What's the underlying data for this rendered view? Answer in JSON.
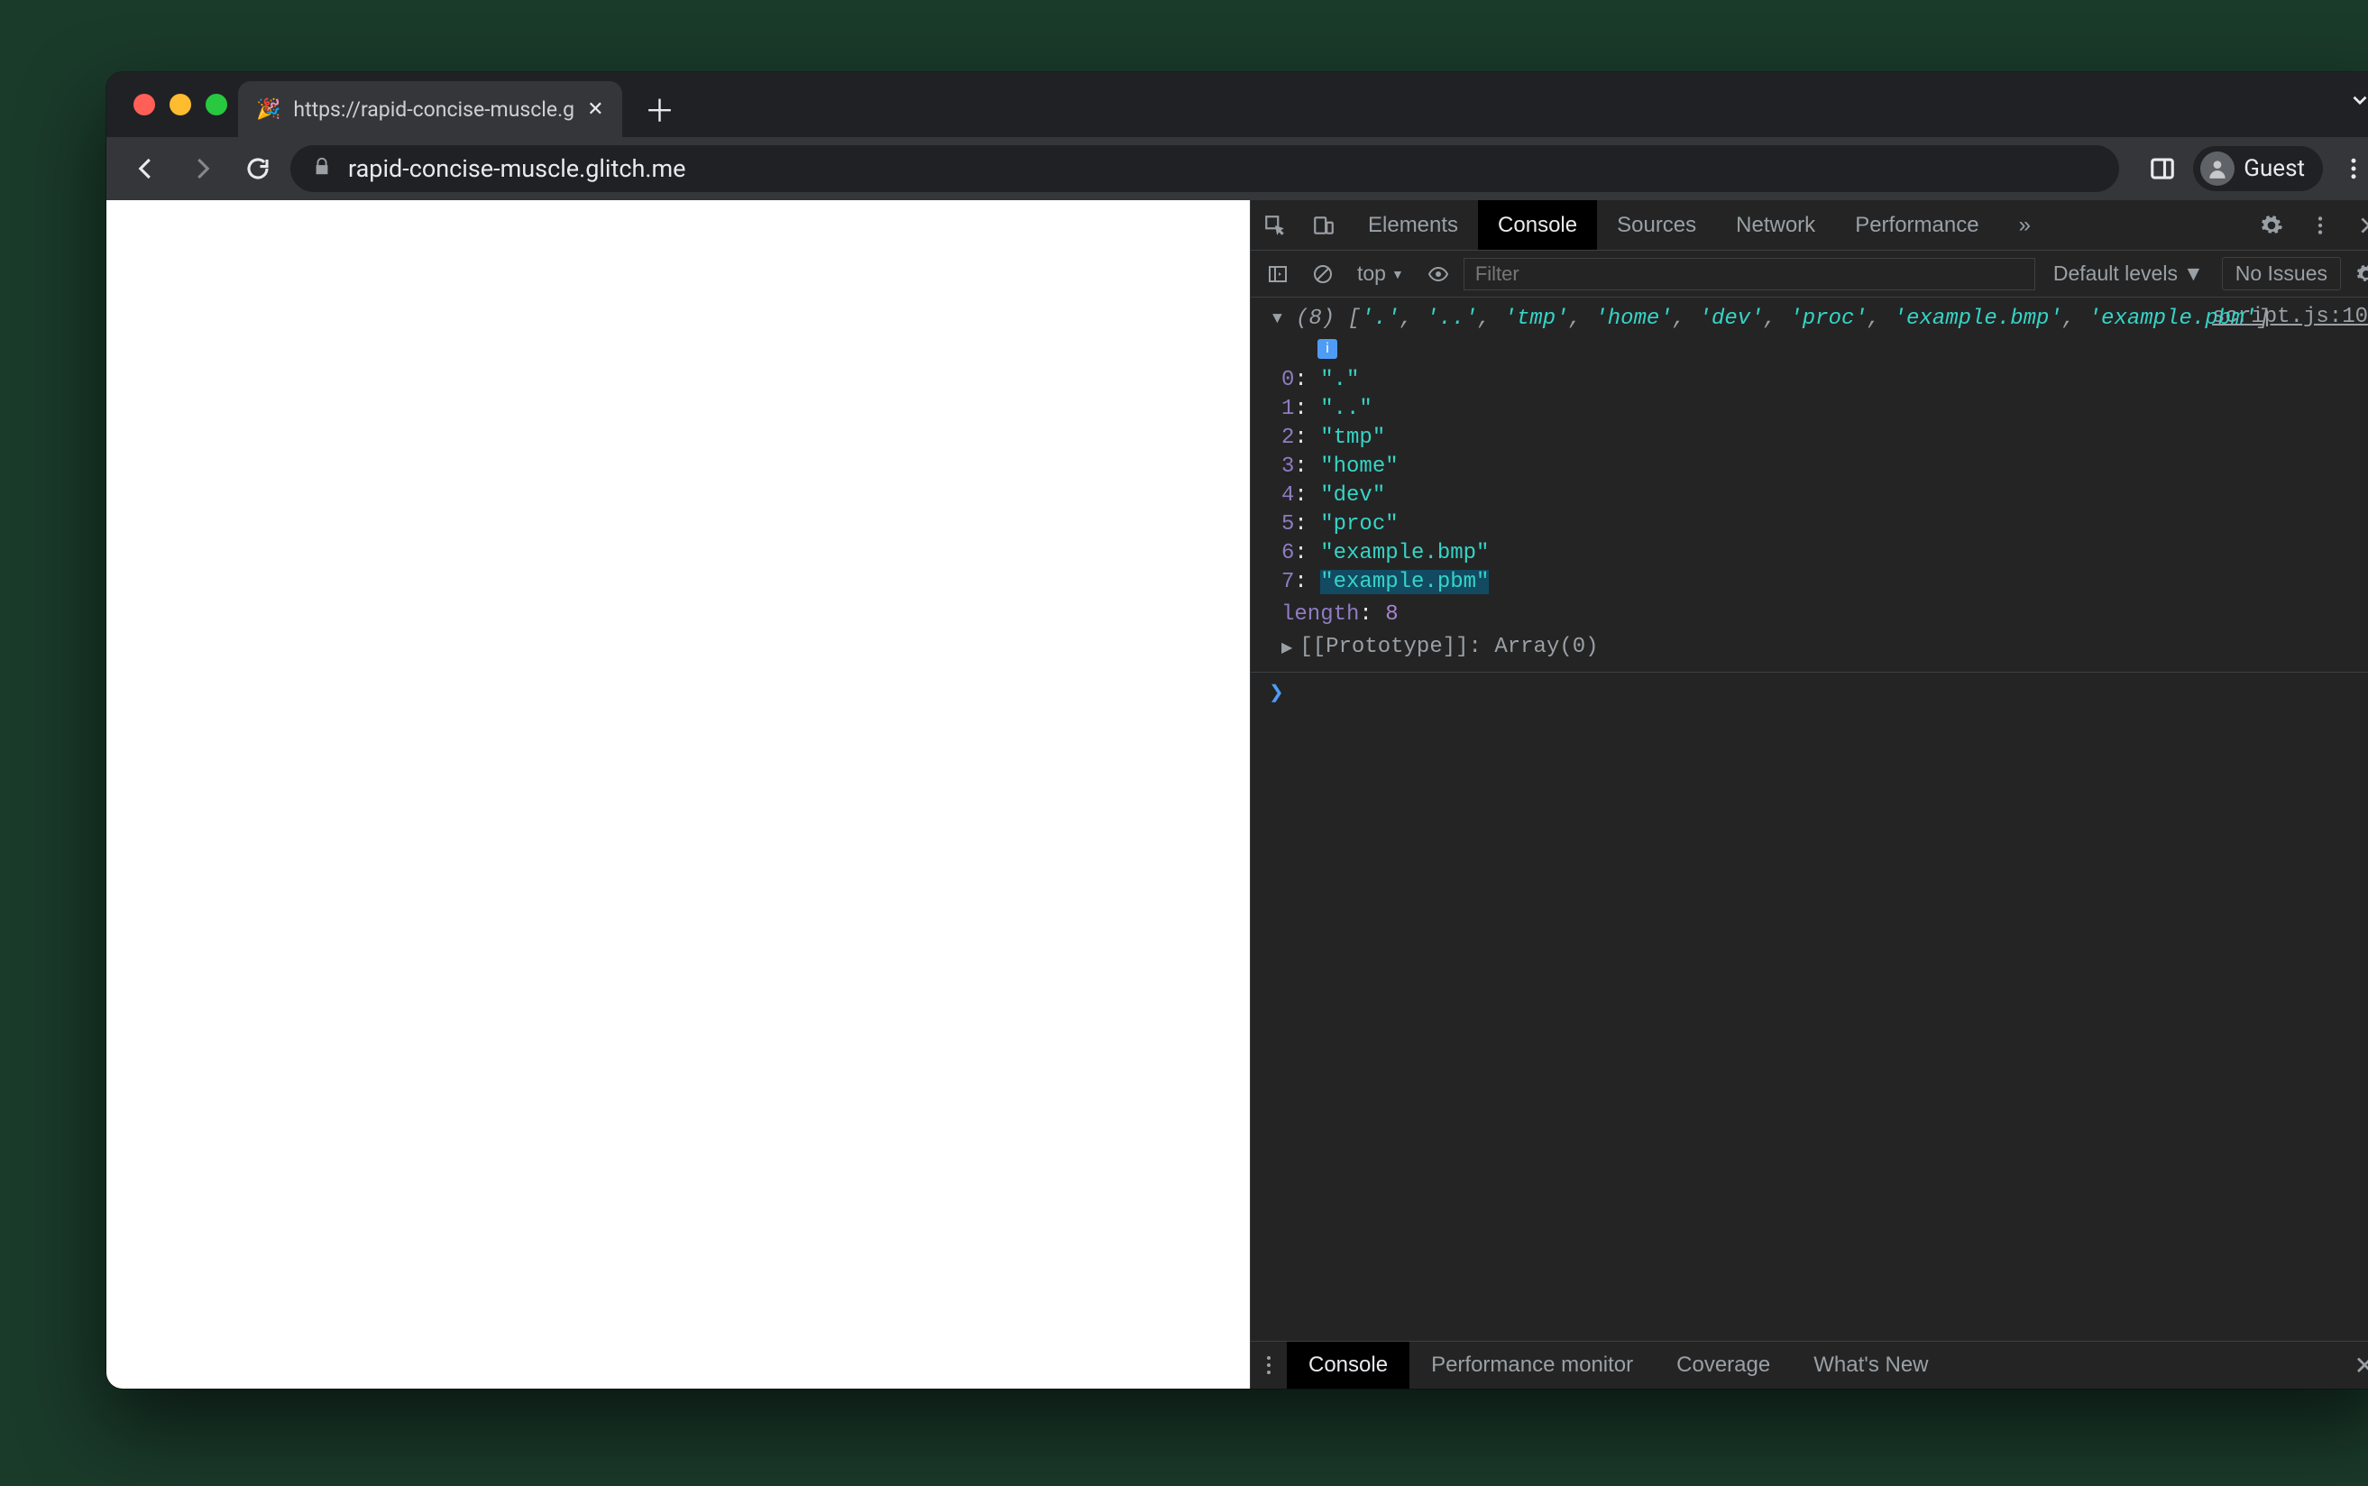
{
  "tab": {
    "favicon": "🎉",
    "title": "https://rapid-concise-muscle.g"
  },
  "omnibox": {
    "url": "rapid-concise-muscle.glitch.me"
  },
  "profile": {
    "label": "Guest"
  },
  "devtools": {
    "tabs": [
      "Elements",
      "Console",
      "Sources",
      "Network",
      "Performance"
    ],
    "active_tab": "Console",
    "console_toolbar": {
      "context": "top",
      "filter_placeholder": "Filter",
      "levels": "Default levels",
      "issues": "No Issues"
    },
    "source_link": "script.js:10",
    "array_length": "(8)",
    "array_summary": [
      "'.'",
      "'..'",
      "'tmp'",
      "'home'",
      "'dev'",
      "'proc'",
      "'example.bmp'",
      "'example.pbm'"
    ],
    "array_items": [
      {
        "idx": "0",
        "val": "\".\""
      },
      {
        "idx": "1",
        "val": "\"..\""
      },
      {
        "idx": "2",
        "val": "\"tmp\""
      },
      {
        "idx": "3",
        "val": "\"home\""
      },
      {
        "idx": "4",
        "val": "\"dev\""
      },
      {
        "idx": "5",
        "val": "\"proc\""
      },
      {
        "idx": "6",
        "val": "\"example.bmp\""
      },
      {
        "idx": "7",
        "val": "\"example.pbm\""
      }
    ],
    "length_label": "length",
    "length_value": "8",
    "prototype": "[[Prototype]]: Array(0)"
  },
  "drawer": {
    "tabs": [
      "Console",
      "Performance monitor",
      "Coverage",
      "What's New"
    ],
    "active": "Console"
  }
}
